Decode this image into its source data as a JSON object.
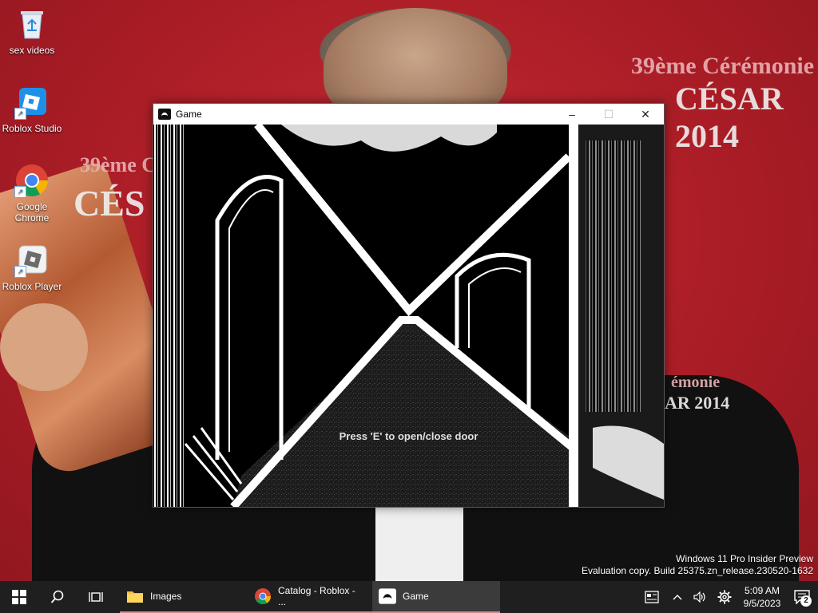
{
  "desktop": {
    "wallpaper_text": [
      "39ème Cérémonie",
      "CÉSAR 2014",
      "39ème Cér",
      "CÉS",
      "émonie",
      "AR 2014"
    ],
    "icons": [
      {
        "label": "sex videos",
        "icon": "recycle-bin-icon"
      },
      {
        "label": "Roblox Studio",
        "icon": "roblox-studio-icon"
      },
      {
        "label": "Google Chrome",
        "icon": "chrome-icon"
      },
      {
        "label": "Roblox Player",
        "icon": "roblox-player-icon"
      }
    ]
  },
  "window": {
    "title": "Game",
    "icon": "game-controller-icon",
    "buttons": {
      "minimize": "–",
      "maximize": "☐",
      "close": "✕"
    },
    "hint": "Press 'E' to open/close door"
  },
  "watermark": {
    "line1": "Windows 11 Pro Insider Preview",
    "line2": "Evaluation copy. Build 25375.zn_release.230520-1632"
  },
  "taskbar": {
    "start_icon": "windows-start-icon",
    "search_icon": "search-icon",
    "taskview_icon": "task-view-icon",
    "apps": [
      {
        "label": "Images",
        "icon": "folder-icon",
        "state": "open"
      },
      {
        "label": "Catalog - Roblox - ...",
        "icon": "chrome-icon",
        "state": "open"
      },
      {
        "label": "Game",
        "icon": "game-controller-icon",
        "state": "active"
      }
    ],
    "tray": [
      "news-icon",
      "chevron-up-icon",
      "volume-icon",
      "settings-icon"
    ],
    "time": "5:09 AM",
    "date": "9/5/2023",
    "notification_count": "2"
  },
  "colors": {
    "wallpaper": "#b3202a",
    "taskbar": "#1f1f1f",
    "accent": "#d38a8a"
  }
}
